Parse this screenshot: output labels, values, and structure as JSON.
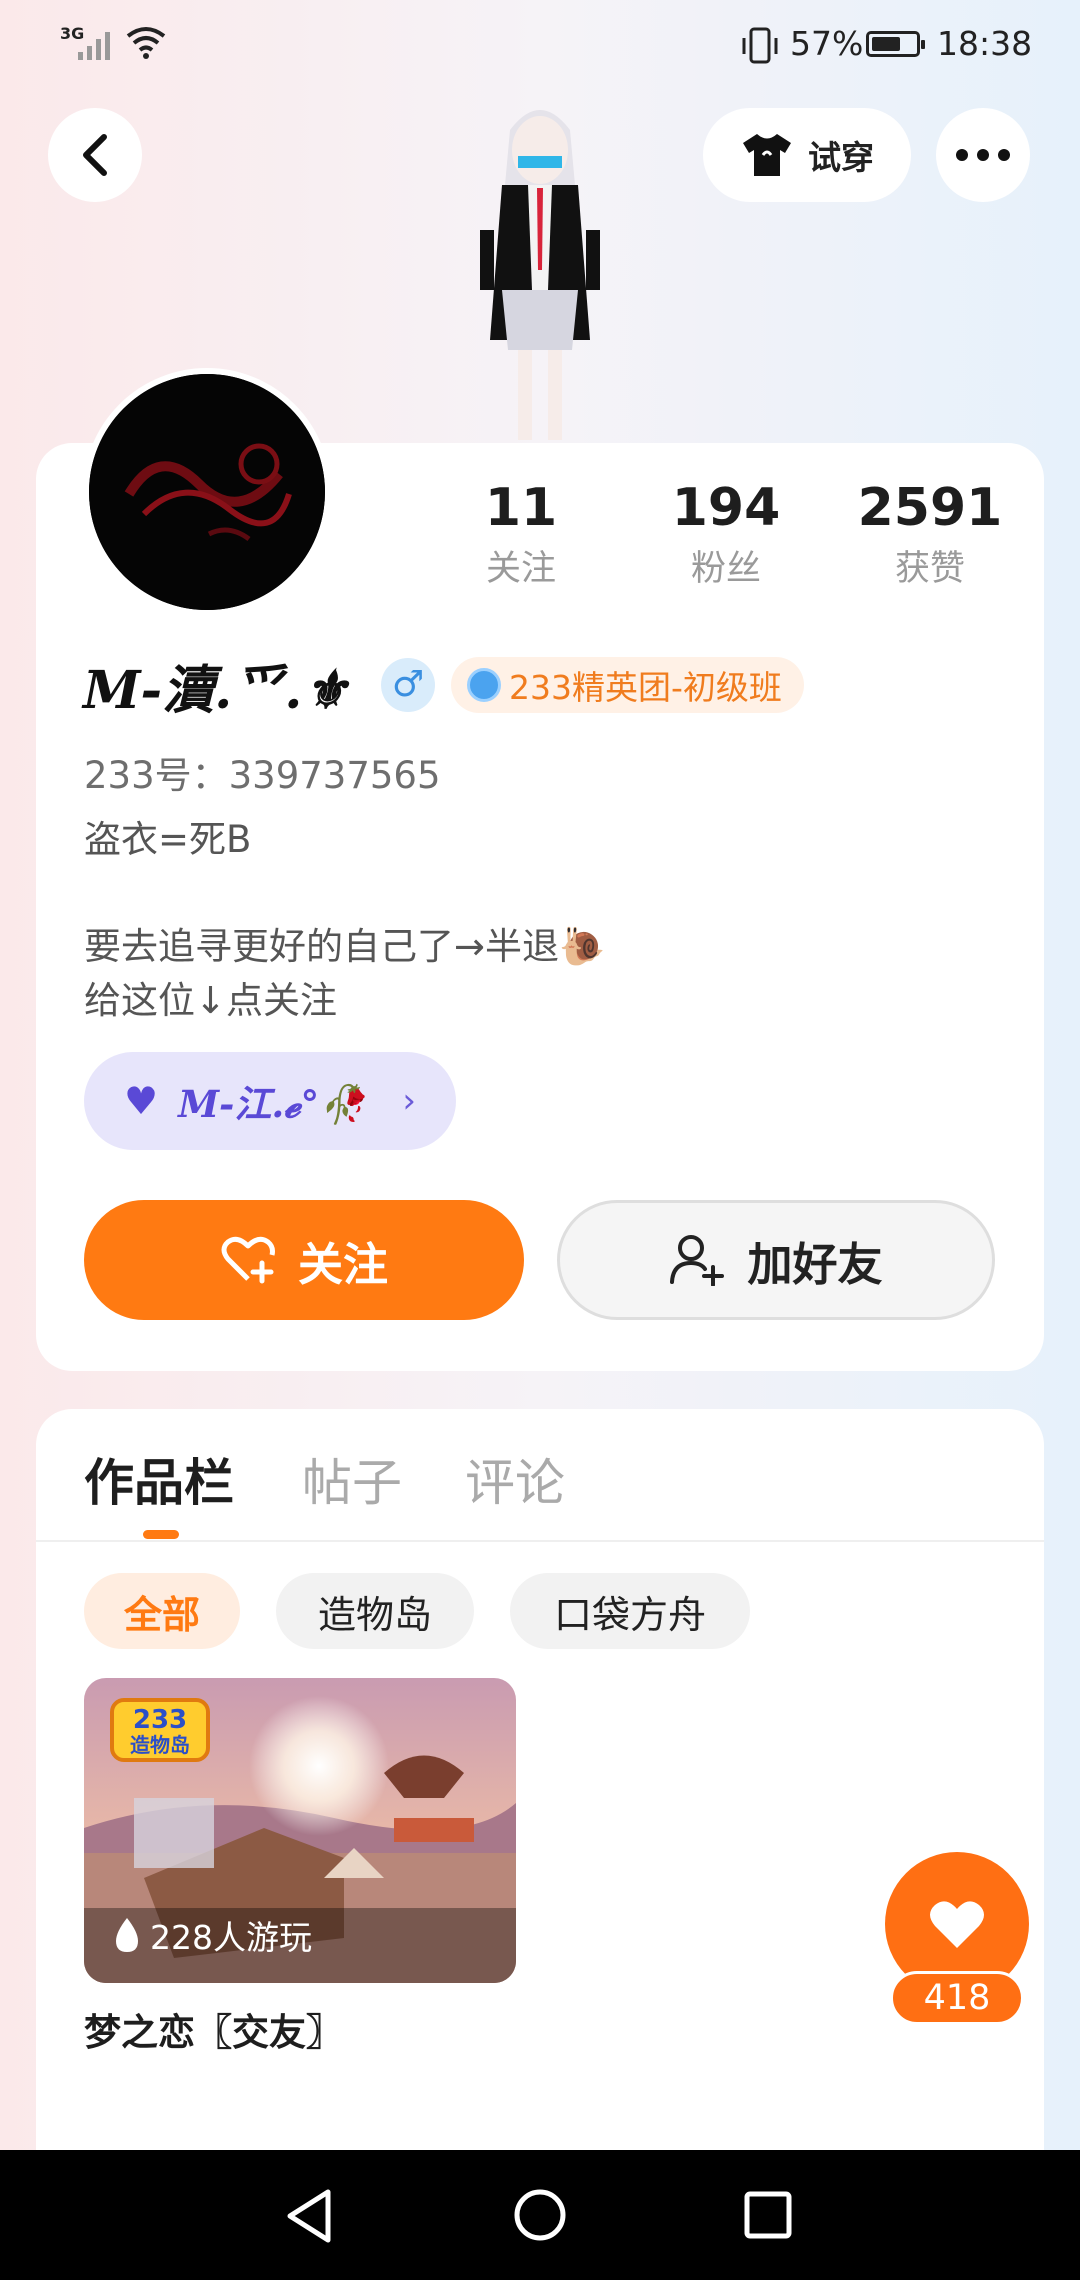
{
  "status_bar": {
    "network": "3G",
    "battery": "57%",
    "time": "18:38"
  },
  "header": {
    "try_on_label": "试穿"
  },
  "profile": {
    "stats": [
      {
        "value": "11",
        "label": "关注"
      },
      {
        "value": "194",
        "label": "粉丝"
      },
      {
        "value": "2591",
        "label": "获赞"
      }
    ],
    "name": "𝑴-瀆.爫.⚜",
    "gender_symbol": "♂",
    "badge": "233精英团-初级班",
    "id_line": "233号：339737565",
    "bio_line1": "盗衣=死B",
    "bio_line2": "要去追寻更好的自己了→半退🐌",
    "bio_line3": "给这位↓点关注",
    "linked_user": "𝑴-江.𝓮°🥀",
    "follow_label": "关注",
    "add_friend_label": "加好友"
  },
  "works": {
    "tabs": [
      "作品栏",
      "帖子",
      "评论"
    ],
    "filters": [
      "全部",
      "造物岛",
      "口袋方舟"
    ],
    "items": [
      {
        "title": "梦之恋〖交友〗",
        "plays": "228人游玩",
        "badge_text": "233 造物岛"
      }
    ]
  },
  "like_count": "418",
  "colors": {
    "accent": "#ff7a12",
    "badge_bg": "#fff1e6",
    "link_pill_bg": "#e7e5fb"
  }
}
